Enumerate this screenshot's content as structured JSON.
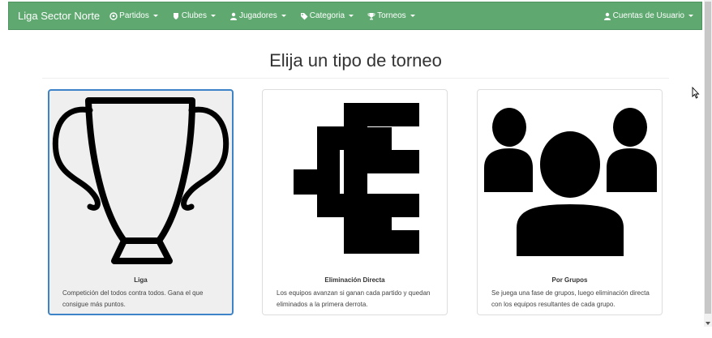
{
  "navbar": {
    "brand": "Liga Sector Norte",
    "items": [
      {
        "label": "Partidos",
        "icon": "soccer-ball-icon"
      },
      {
        "label": "Clubes",
        "icon": "shield-icon"
      },
      {
        "label": "Jugadores",
        "icon": "user-icon"
      },
      {
        "label": "Categoria",
        "icon": "tag-icon"
      },
      {
        "label": "Torneos",
        "icon": "trophy-icon"
      }
    ],
    "account": {
      "label": "Cuentas de Usuario",
      "icon": "user-icon"
    }
  },
  "page": {
    "title": "Elija un tipo de torneo"
  },
  "cards": [
    {
      "label": "Liga",
      "description": "Competición del todos contra todos. Gana el que consigue más puntos.",
      "icon": "trophy-icon",
      "selected": true
    },
    {
      "label": "Eliminación Directa",
      "description": "Los equipos avanzan si ganan cada partido y quedan eliminados a la primera derrota.",
      "icon": "bracket-icon",
      "selected": false
    },
    {
      "label": "Por Grupos",
      "description": "Se juega una fase de grupos, luego eliminación directa con los equipos resultantes de cada grupo.",
      "icon": "group-icon",
      "selected": false
    }
  ],
  "colors": {
    "navbar": "#5fa970",
    "selected_border": "#3d83c7",
    "selected_bg": "#efefef"
  }
}
